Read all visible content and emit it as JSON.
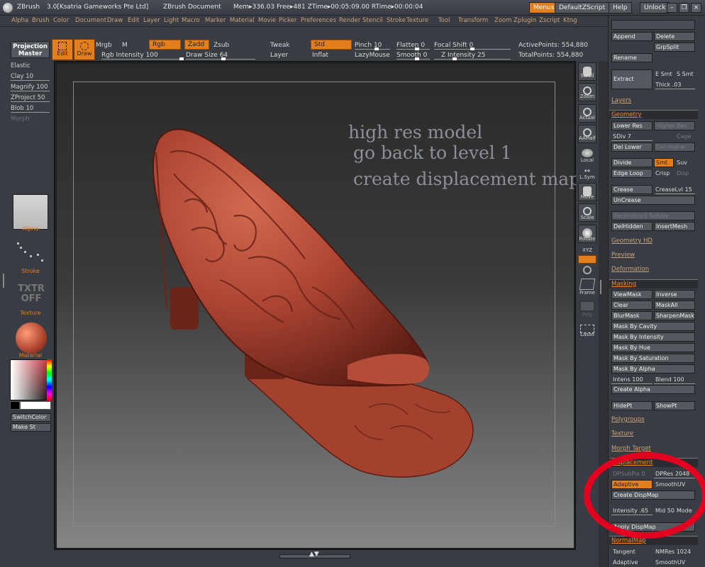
{
  "titlebar": {
    "app": "ZBrush",
    "info": "3.0[Ksatria Gameworks Pte Ltd]",
    "document": "ZBrush Document",
    "mem": "Mem▸336.03 Free▸481 ZTime▸00:05:09.00 RTime▸00:00:04",
    "btn_menus": "Menus",
    "btn_default_zscript": "DefaultZScript",
    "btn_help": "Help",
    "btn_unlock": "Unlock"
  },
  "menubar": [
    "Alpha",
    "Brush",
    "Color",
    "Document",
    "Draw",
    "Edit",
    "Layer",
    "Light",
    "Macro",
    "Marker",
    "Material",
    "Movie",
    "Picker",
    "Preferences",
    "Render",
    "Stencil",
    "Stroke",
    "Texture",
    "Tool",
    "Transform",
    "Zoom",
    "Zplugin",
    "Zscript",
    "Ktng"
  ],
  "toolbar": {
    "projection_master": "Projection\nMaster",
    "edit": "Edit",
    "draw": "Draw",
    "mrgb": "Mrgb",
    "m": "M",
    "rgb": "Rgb",
    "zadd": "Zadd",
    "zsub": "Zsub",
    "rgb_intensity": "Rgb Intensity 100",
    "draw_size": "Draw Size 64",
    "tweak": "Tweak",
    "layer": "Layer",
    "std": "Std",
    "inflat": "Inflat",
    "pinch": "Pinch 10",
    "lazymouse": "LazyMouse",
    "flatten": "Flatten 0",
    "smooth": "Smooth 0",
    "focal_shift": "Focal Shift 0",
    "z_intensity": "Z Intensity 25",
    "active_points": "ActivePoints: 554,880",
    "total_points": "TotalPoints: 554,880"
  },
  "leftpanel": {
    "brushes": [
      "Elastic",
      "Clay 10",
      "Magnify 100",
      "ZProject 50",
      "Blob 10",
      "Morph"
    ],
    "alpha": "Alpha",
    "stroke": "Stroke",
    "texture": "Texture",
    "material": "Material",
    "switchcolor": "SwitchColor",
    "make_st": "Make St"
  },
  "canvas": {
    "annotations": [
      "high res model",
      "go back to level 1",
      "create displacement map"
    ]
  },
  "rstrip": [
    "Scroll",
    "Zoom",
    "Actual",
    "AAHalf",
    "Local",
    "L.Sym",
    "Move",
    "Scale",
    "Rotate",
    "XYZ",
    "Frame",
    "Poly",
    "Lasso"
  ],
  "rpanel": {
    "append": "Append",
    "delete": "Delete",
    "grpsplit": "GrpSplit",
    "rename": "Rename",
    "extract": "Extract",
    "e_smt": "E Smt",
    "s_smt": "S Smt",
    "thick": "Thick .03",
    "layers": "Layers",
    "geometry": "Geometry",
    "lower_res": "Lower Res",
    "higher_res": "Higher Res",
    "sdiv": "SDiv 7",
    "cage": "Cage",
    "del_lower": "Del Lower",
    "del_higher": "Del Higher",
    "divide": "Divide",
    "smt": "Smt",
    "suv": "Suv",
    "edge_loop": "Edge Loop",
    "crisp": "Crisp",
    "disp": "Disp",
    "crease": "Crease",
    "creaselvl": "CreaseLvl 15",
    "uncrease": "UnCrease",
    "reconstruct": "Reconstruct Subdiv",
    "delhidden": "DelHidden",
    "insertmesh": "InsertMesh",
    "geometry_hd": "Geometry HD",
    "preview": "Preview",
    "deformation": "Deformation",
    "masking": "Masking",
    "viewmask": "ViewMask",
    "inverse": "Inverse",
    "clear": "Clear",
    "maskall": "MaskAll",
    "blurmask": "BlurMask",
    "sharpenmask": "SharpenMask",
    "mask_by_cavity": "Mask By Cavity",
    "mask_by_intensity": "Mask By Intensity",
    "mask_by_hue": "Mask By Hue",
    "mask_by_saturation": "Mask By Saturation",
    "mask_by_alpha": "Mask By Alpha",
    "intens": "Intens 100",
    "blend": "Blend 100",
    "create_alpha": "Create Alpha",
    "hidept": "HidePt",
    "showpt": "ShowPt",
    "polygroups": "Polygroups",
    "texture": "Texture",
    "morph_target": "Morph Target",
    "displacement": "Displacement",
    "dpsubpix": "DPSubPix 0",
    "dpres": "DPRes 2048",
    "adaptive": "Adaptive",
    "smoothuv": "SmoothUV",
    "create_dispmap": "Create DispMap",
    "intensity": "Intensity .65",
    "mid": "Mid 50",
    "mode": "Mode",
    "apply_dispmap": "Apply DispMap",
    "normalmap": "NormalMap",
    "tangent": "Tangent",
    "nmres": "NMRes 1024",
    "adaptive2": "Adaptive",
    "smoothuv2": "SmoothUV"
  },
  "colors": {
    "accent": "#e37e1d",
    "panel": "#3a3c43",
    "model": "#b24a36",
    "annotation_circle": "#e4001f"
  }
}
